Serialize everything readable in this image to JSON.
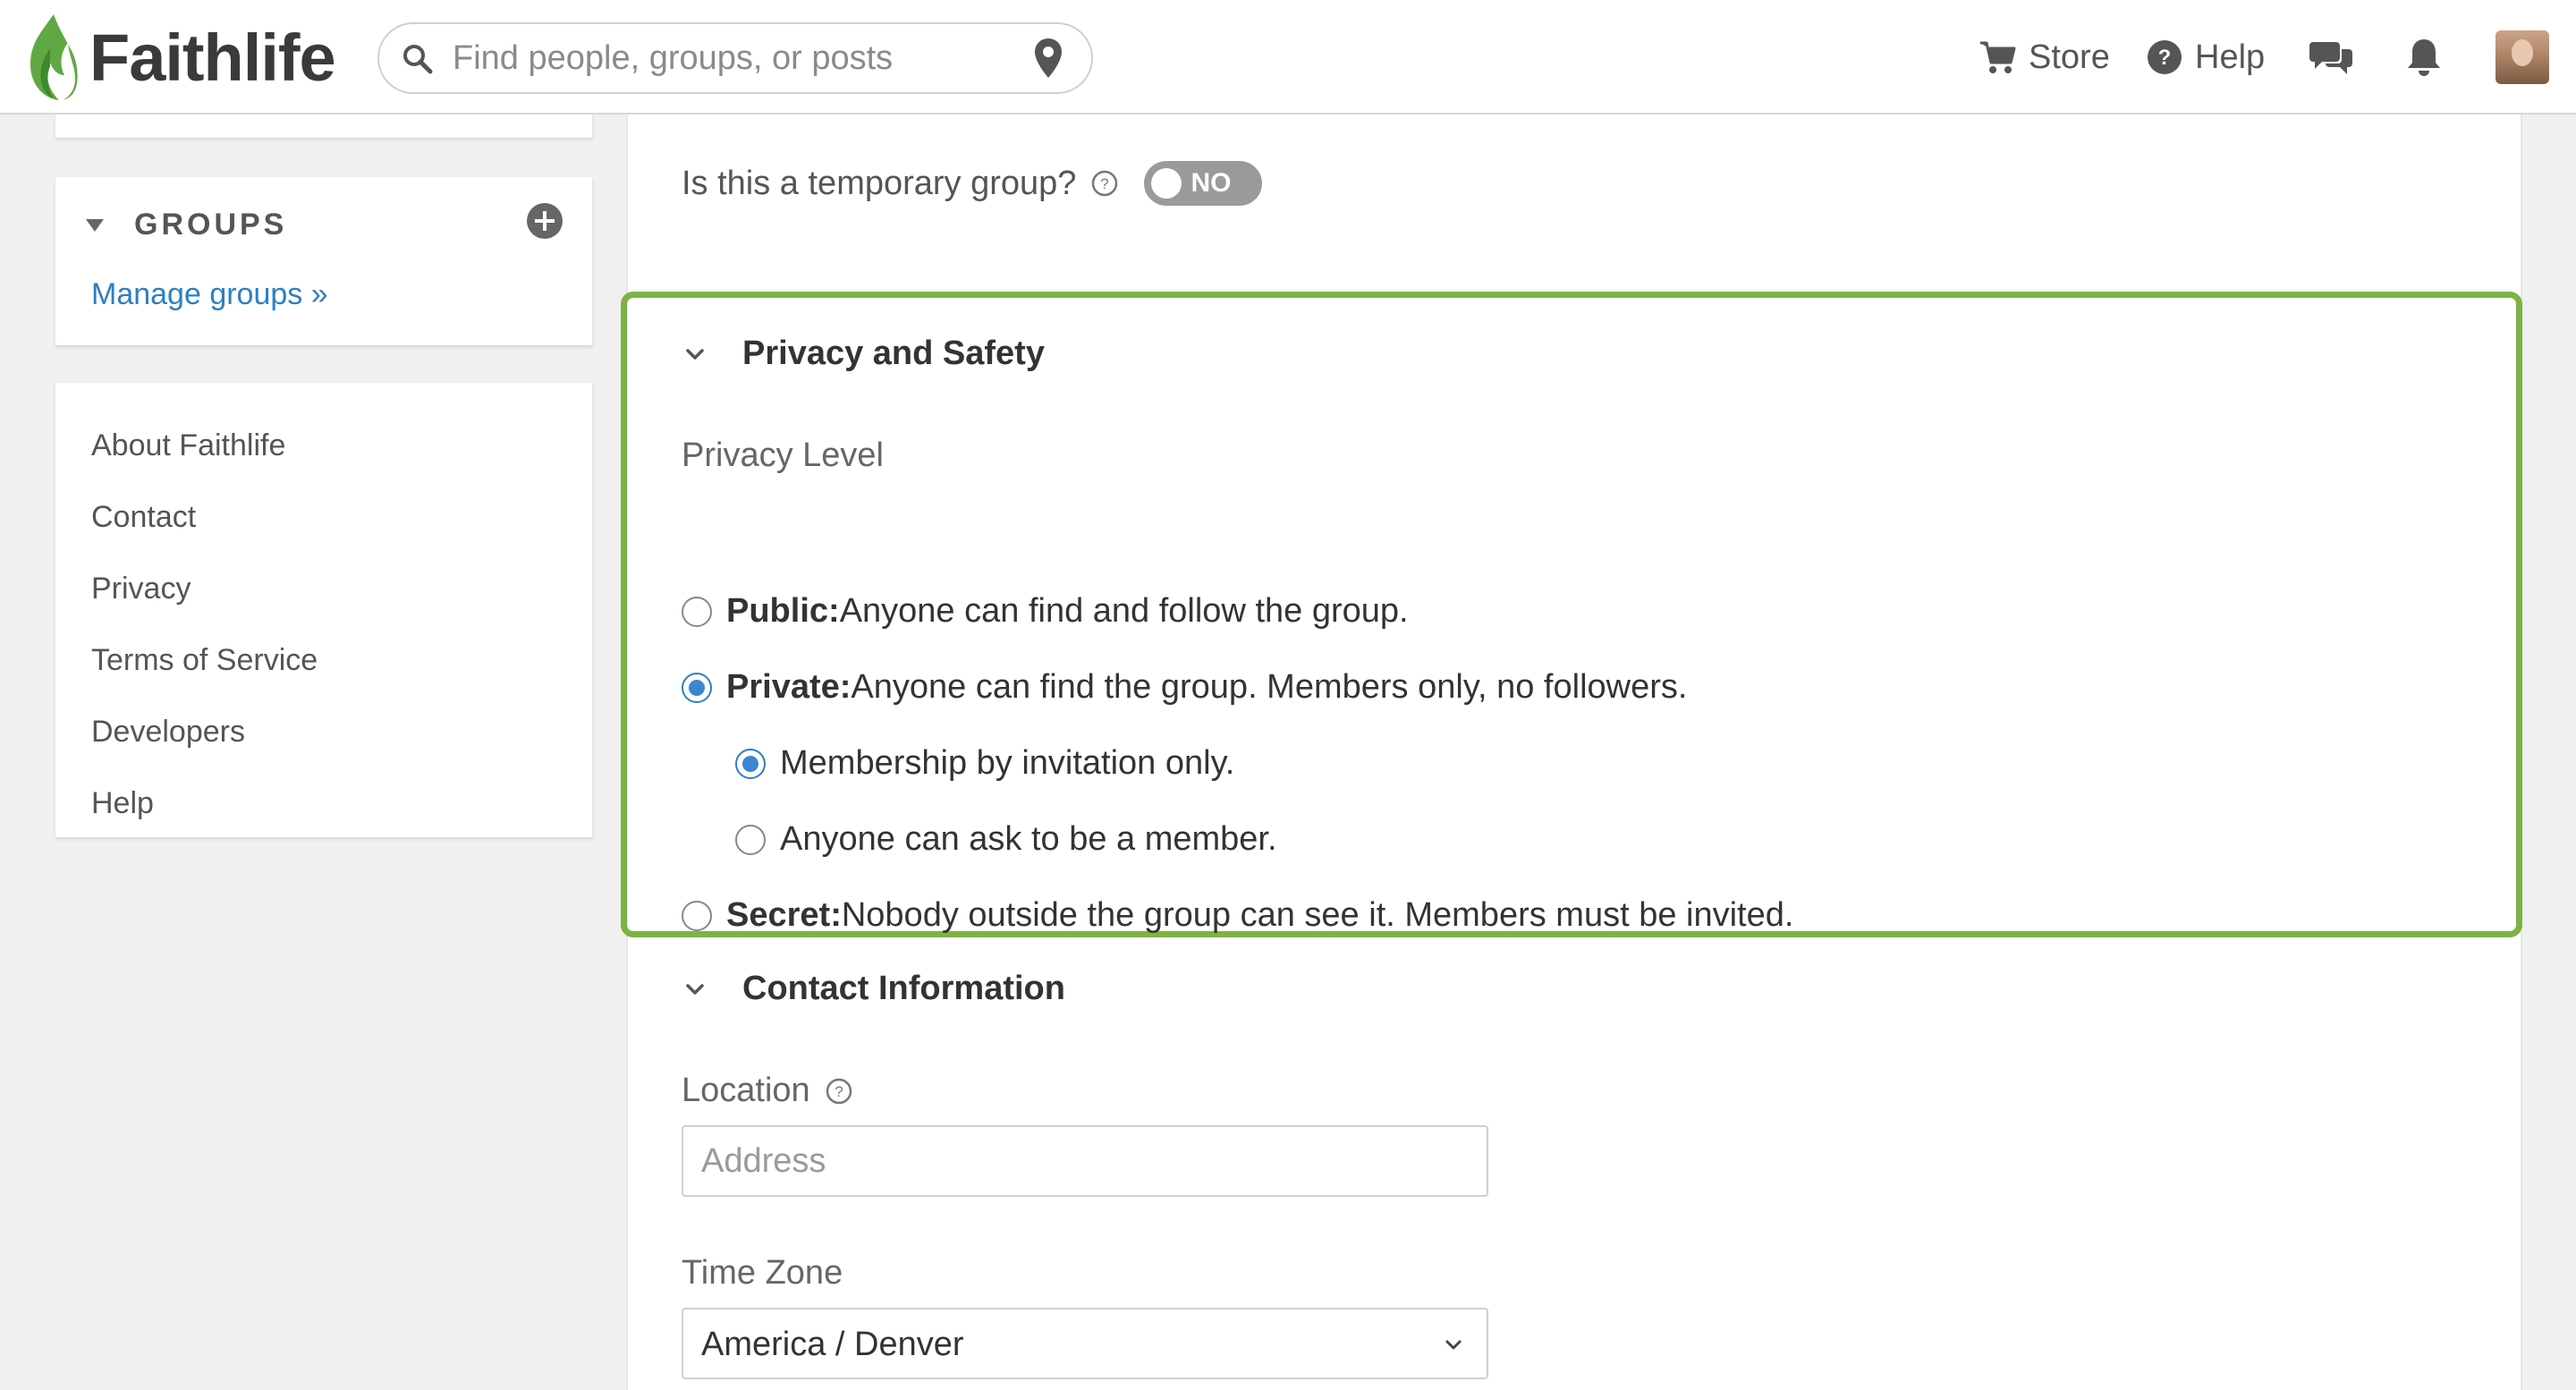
{
  "header": {
    "logo_text": "Faithlife",
    "search_placeholder": "Find people, groups, or posts",
    "store_label": "Store",
    "help_label": "Help",
    "brand_color": "#5fa843"
  },
  "sidebar": {
    "groups_title": "GROUPS",
    "manage_groups": "Manage groups »",
    "links": [
      "About Faithlife",
      "Contact",
      "Privacy",
      "Terms of Service",
      "Developers",
      "Help"
    ]
  },
  "main": {
    "temporary_label": "Is this a temporary group?",
    "temporary_toggle": "NO",
    "privacy": {
      "title": "Privacy and Safety",
      "level_label": "Privacy Level",
      "options": [
        {
          "title": "Public:",
          "desc": "Anyone can find and follow the group.",
          "selected": false
        },
        {
          "title": "Private:",
          "desc": "Anyone can find the group. Members only, no followers.",
          "selected": true
        },
        {
          "title": "Secret:",
          "desc": "Nobody outside the group can see it. Members must be invited.",
          "selected": false
        }
      ],
      "sub_options": [
        {
          "label": "Membership by invitation only.",
          "selected": true
        },
        {
          "label": "Anyone can ask to be a member.",
          "selected": false
        }
      ],
      "highlight_color": "#7cb342"
    },
    "contact": {
      "title": "Contact Information",
      "location_label": "Location",
      "address_placeholder": "Address",
      "timezone_label": "Time Zone",
      "timezone_value": "America / Denver"
    }
  }
}
